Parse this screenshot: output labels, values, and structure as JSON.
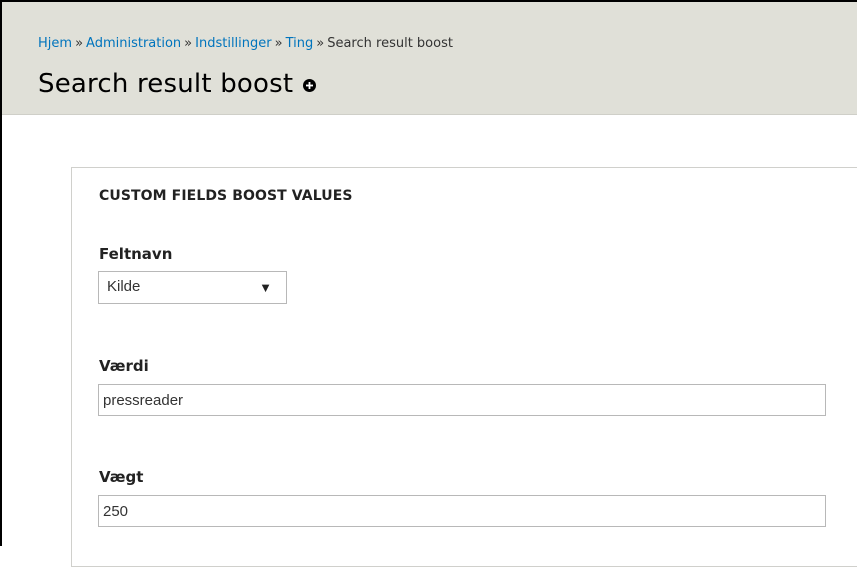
{
  "breadcrumb": {
    "items": [
      "Hjem",
      "Administration",
      "Indstillinger",
      "Ting"
    ],
    "current": "Search result boost",
    "separator": "»"
  },
  "page": {
    "title": "Search result boost",
    "add_icon": "plus-circle-icon"
  },
  "form": {
    "legend": "CUSTOM FIELDS BOOST VALUES",
    "field_name": {
      "label": "Feltnavn",
      "value": "Kilde",
      "arrow": "▼"
    },
    "value": {
      "label": "Værdi",
      "value": "pressreader"
    },
    "weight": {
      "label": "Vægt",
      "value": "250"
    }
  },
  "colors": {
    "header_bg": "#e0e0d8",
    "link": "#0074bd"
  }
}
